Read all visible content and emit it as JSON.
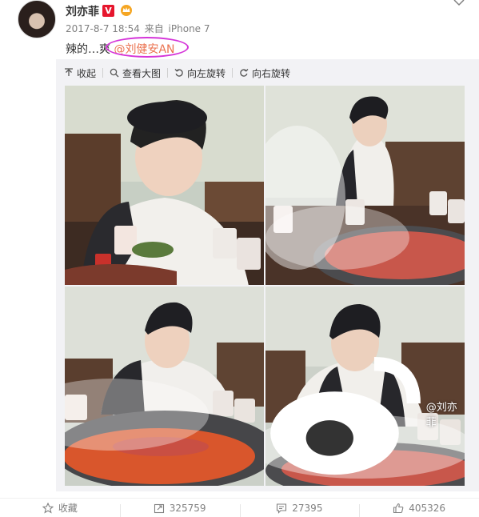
{
  "user": {
    "name": "刘亦菲",
    "verified_badge": "V",
    "crown_icon": "crown-icon"
  },
  "meta": {
    "timestamp": "2017-8-7 18:54",
    "source_prefix": "来自",
    "source_device": "iPhone 7"
  },
  "post": {
    "text": "辣的…爽",
    "mention": "@刘健安AN"
  },
  "toolbar": {
    "collapse_label": "收起",
    "view_large_label": "查看大图",
    "rotate_left_label": "向左旋转",
    "rotate_right_label": "向右旋转"
  },
  "photos": {
    "watermark": "@刘亦菲"
  },
  "actions": {
    "favorite_label": "收藏",
    "repost_count": "325759",
    "comment_count": "27395",
    "like_count": "405326"
  },
  "colors": {
    "mention": "#eb7350",
    "highlight_circle": "#d535d9",
    "badge": "#e6162d"
  }
}
